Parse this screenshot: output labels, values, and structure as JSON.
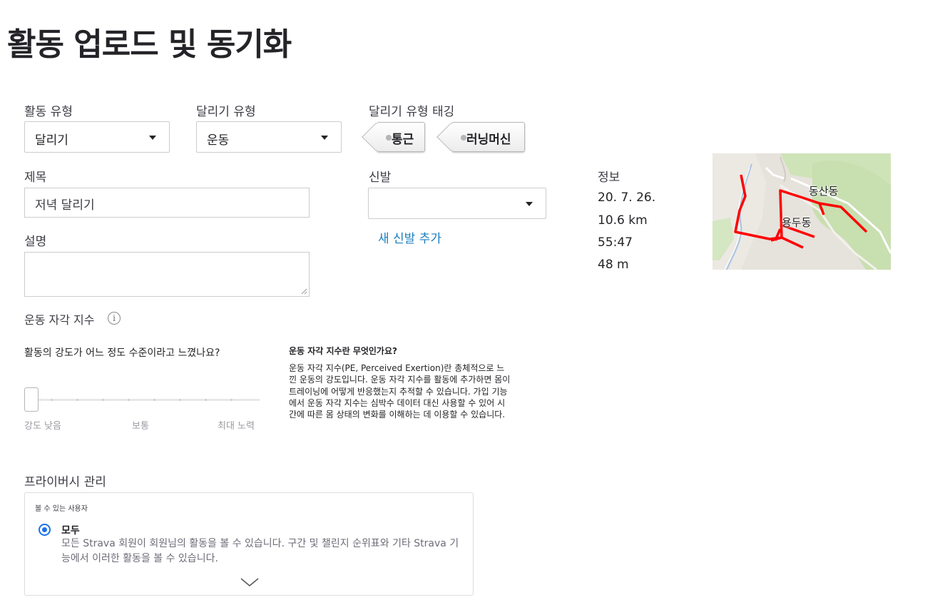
{
  "page": {
    "title": "활동 업로드 및 동기화"
  },
  "activity_type": {
    "label": "활동 유형",
    "value": "달리기"
  },
  "run_type": {
    "label": "달리기 유형",
    "value": "운동"
  },
  "run_tagging": {
    "label": "달리기 유형 태깅",
    "tags": [
      "통근",
      "러닝머신"
    ]
  },
  "title_field": {
    "label": "제목",
    "value": "저녁 달리기"
  },
  "description_field": {
    "label": "설명",
    "value": ""
  },
  "shoes": {
    "label": "신발",
    "value": "",
    "add_link": "새 신발 추가"
  },
  "info": {
    "label": "정보",
    "date": "20. 7. 26.",
    "distance": "10.6 km",
    "time": "55:47",
    "elevation": "48 m"
  },
  "map": {
    "labels": [
      "동산동",
      "용두동"
    ],
    "route_color": "#ff0000"
  },
  "perceived_exertion": {
    "label": "운동 자각 지수",
    "info_icon": "info-icon",
    "question": "활동의 강도가 어느 정도 수준이라고 느꼈나요?",
    "scale": {
      "low": "강도 낮음",
      "mid": "보통",
      "high": "최대 노력"
    },
    "value": 0,
    "help_title": "운동 자각 지수란 무엇인가요?",
    "help_body": "운동 자각 지수(PE, Perceived Exertion)란 총체적으로 느낀 운동의 강도입니다. 운동 자각 지수를 활동에 추가하면 몸이 트레이닝에 어떻게 반응했는지 추적할 수 있습니다. 가입 기능에서 운동 자각 지수는 심박수 데이터 대신 사용할 수 있어 시간에 따른 몸 상태의 변화를 이해하는 데 이용할 수 있습니다."
  },
  "privacy": {
    "label": "프라이버시 관리",
    "visibility_label": "볼 수 있는 사용자",
    "selected_option": {
      "title": "모두",
      "description": "모든 Strava 회원이 회원님의 활동을 볼 수 있습니다. 구간 및 챌린지 순위표와 기타 Strava 기능에서 이러한 활동을 볼 수 있습니다."
    }
  },
  "colors": {
    "link": "#1a7fc0",
    "radio": "#1a73e8"
  }
}
